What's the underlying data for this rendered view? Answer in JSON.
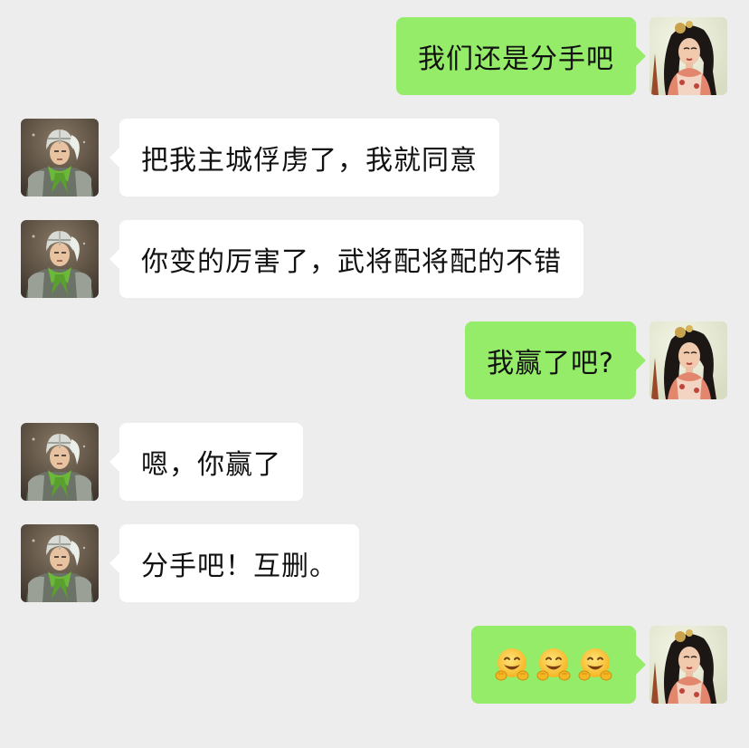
{
  "messages": [
    {
      "side": "right",
      "avatar": "female-general-avatar",
      "text": "我们还是分手吧"
    },
    {
      "side": "left",
      "avatar": "male-general-avatar",
      "text": "把我主城俘虏了，我就同意"
    },
    {
      "side": "left",
      "avatar": "male-general-avatar",
      "text": "你变的厉害了，武将配将配的不错"
    },
    {
      "side": "right",
      "avatar": "female-general-avatar",
      "text": "我赢了吧?"
    },
    {
      "side": "left",
      "avatar": "male-general-avatar",
      "text": "嗯，你赢了"
    },
    {
      "side": "left",
      "avatar": "male-general-avatar",
      "text": "分手吧！互删。"
    },
    {
      "side": "right",
      "avatar": "female-general-avatar",
      "emojis": [
        "hugging-face-emoji",
        "hugging-face-emoji",
        "hugging-face-emoji"
      ]
    }
  ],
  "colors": {
    "background": "#ededed",
    "sent_bubble": "#95ec69",
    "received_bubble": "#ffffff",
    "text": "#111111"
  }
}
